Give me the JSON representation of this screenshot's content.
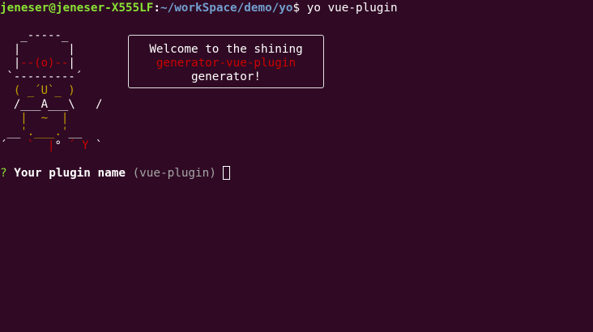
{
  "prompt_line": {
    "user_host": "jeneser@jeneser-X555LF",
    "separator": ":",
    "path": "~/workSpace/demo/yo",
    "dollar": "$",
    "command": " yo vue-plugin"
  },
  "yo_art": {
    "r1": "   _-----_",
    "r2": "  |       |",
    "r3a": "  |",
    "r3b": "--(o)--",
    "r3c": "|",
    "r4": " `---------´",
    "r5": "  ( _´U`_ )",
    "r6": "  /___A___\\   /",
    "r7": "   |  ~  |",
    "r8a": " __",
    "r8b": "'.___.'",
    "r8c": "__",
    "r9a": "´   ",
    "r9b": "`  |",
    "r9c": "° ",
    "r9d": "´ Y",
    "r9e": " `"
  },
  "welcome": {
    "line1": "Welcome to the shining",
    "line2": "generator-vue-plugin",
    "line3": "generator!"
  },
  "question": {
    "marker": "?",
    "label": "Your plugin name",
    "default_value": "(vue-plugin)"
  },
  "colors": {
    "background": "#300a24",
    "prompt_user": "#8ae234",
    "prompt_path": "#729fcf",
    "accent_red": "#cc0000",
    "accent_yellow": "#c4a000"
  }
}
